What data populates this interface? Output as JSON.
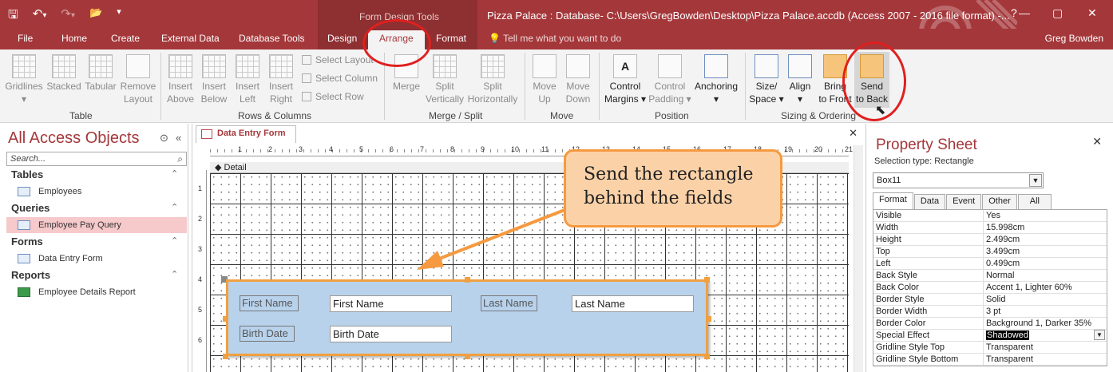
{
  "titlebar": {
    "context_tools": "Form Design Tools",
    "window_title": "Pizza Palace : Database- C:\\Users\\GregBowden\\Desktop\\Pizza Palace.accdb (Access 2007 - 2016 file format) -...",
    "qat": {
      "save": "🖫",
      "undo": "↶",
      "undo_dd": "▾",
      "redo": "↷",
      "redo_dd": "▾",
      "open": "📂",
      "customize": "▾"
    },
    "controls": {
      "minimize": "—",
      "restore": "▢",
      "close": "✕",
      "help": "?"
    }
  },
  "tabs": {
    "file": "File",
    "home": "Home",
    "create": "Create",
    "external": "External Data",
    "dbtools": "Database Tools",
    "design": "Design",
    "arrange": "Arrange",
    "format": "Format",
    "tellme": "Tell me what you want to do",
    "user": "Greg Bowden"
  },
  "ribbon": {
    "table": {
      "gridlines": "Gridlines",
      "stacked": "Stacked",
      "tabular": "Tabular",
      "remove": "Remove",
      "remove2": "Layout",
      "group": "Table"
    },
    "rows": {
      "insert_above": "Insert",
      "insert_above2": "Above",
      "insert_below": "Insert",
      "insert_below2": "Below",
      "insert_left": "Insert",
      "insert_left2": "Left",
      "insert_right": "Insert",
      "insert_right2": "Right",
      "select_layout": "Select Layout",
      "select_column": "Select Column",
      "select_row": "Select Row",
      "group": "Rows & Columns"
    },
    "merge": {
      "merge": "Merge",
      "split_v": "Split",
      "split_v2": "Vertically",
      "split_h": "Split",
      "split_h2": "Horizontally",
      "group": "Merge / Split"
    },
    "move": {
      "up": "Move",
      "up2": "Up",
      "down": "Move",
      "down2": "Down",
      "group": "Move"
    },
    "position": {
      "margins": "Control",
      "margins2": "Margins ▾",
      "padding": "Control",
      "padding2": "Padding ▾",
      "anchoring": "Anchoring",
      "anchoring2": "▾",
      "group": "Position"
    },
    "sizing": {
      "size": "Size/",
      "size2": "Space ▾",
      "align": "Align",
      "align2": "▾",
      "front": "Bring",
      "front2": "to Front",
      "back": "Send",
      "back2": "to Back",
      "group": "Sizing & Ordering"
    }
  },
  "nav": {
    "title": "All Access Objects",
    "menu": "⊙",
    "collapse": "«",
    "search_placeholder": "Search...",
    "search_icon": "⌕",
    "groups": {
      "tables": "Tables",
      "queries": "Queries",
      "forms": "Forms",
      "reports": "Reports",
      "chev": "⌃"
    },
    "items": {
      "employees": "Employees",
      "pay_query": "Employee Pay Query",
      "entry_form": "Data Entry Form",
      "details_report": "Employee Details Report"
    }
  },
  "document": {
    "tab": "Data Entry Form",
    "close": "✕",
    "detail": "◆ Detail",
    "ruler_h": [
      "1",
      "2",
      "3",
      "4",
      "5",
      "6",
      "7",
      "8",
      "9",
      "10",
      "11",
      "12",
      "13",
      "14",
      "15",
      "16",
      "17",
      "18",
      "19",
      "20",
      "21"
    ],
    "ruler_v": [
      "1",
      "2",
      "3",
      "4",
      "5",
      "6"
    ],
    "controls": {
      "first_name_label": "First Name",
      "first_name_box": "First Name",
      "last_name_label": "Last Name",
      "last_name_box": "Last Name",
      "birth_date_label": "Birth Date",
      "birth_date_box": "Birth Date"
    }
  },
  "callout": {
    "line1": "Send the rectangle",
    "line2": "behind the fields"
  },
  "property_sheet": {
    "title": "Property Sheet",
    "close": "✕",
    "selection_type": "Selection type:  Rectangle",
    "selected": "Box11",
    "tabs": [
      "Format",
      "Data",
      "Event",
      "Other",
      "All"
    ],
    "rows": [
      [
        "Visible",
        "Yes"
      ],
      [
        "Width",
        "15.998cm"
      ],
      [
        "Height",
        "2.499cm"
      ],
      [
        "Top",
        "3.499cm"
      ],
      [
        "Left",
        "0.499cm"
      ],
      [
        "Back Style",
        "Normal"
      ],
      [
        "Back Color",
        "Accent 1, Lighter 60%"
      ],
      [
        "Border Style",
        "Solid"
      ],
      [
        "Border Width",
        "3 pt"
      ],
      [
        "Border Color",
        "Background 1, Darker 35%"
      ],
      [
        "Special Effect",
        "Shadowed"
      ],
      [
        "Gridline Style Top",
        "Transparent"
      ],
      [
        "Gridline Style Bottom",
        "Transparent"
      ]
    ]
  },
  "colors": {
    "accent": "#a4373a",
    "rect_fill": "#b8d2ec",
    "selection": "#f0a040",
    "annotation": "#e0201f"
  }
}
